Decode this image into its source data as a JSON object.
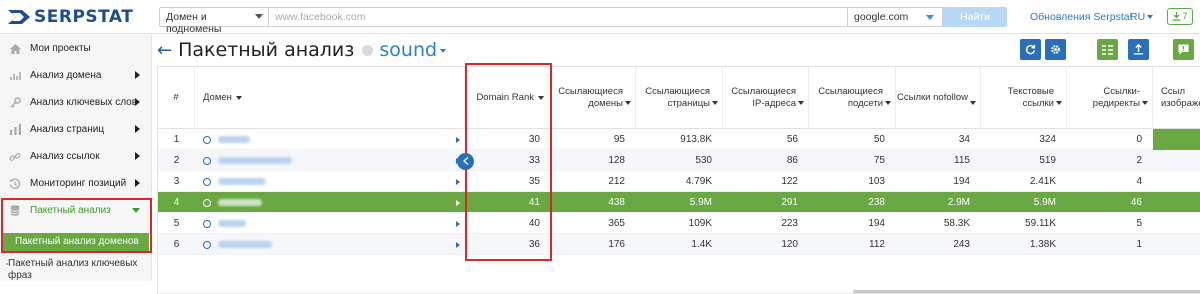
{
  "app": {
    "logo_text": "SERPSTAT",
    "search_type": "Домен и подномены",
    "search_placeholder": "www.facebook.com",
    "engine": "google.com",
    "find_label": "Найти",
    "updates_label": "Обновления Serpstat",
    "lang": "RU",
    "download_count": "7"
  },
  "sidebar": {
    "items": [
      {
        "label": "Мои проекты",
        "icon": "home-icon"
      },
      {
        "label": "Анализ домена",
        "icon": "domain-chart-icon"
      },
      {
        "label": "Анализ ключевых слов",
        "icon": "key-icon"
      },
      {
        "label": "Анализ страниц",
        "icon": "bar-chart-icon"
      },
      {
        "label": "Анализ ссылок",
        "icon": "link-icon"
      },
      {
        "label": "Мониторинг позиций",
        "icon": "history-icon"
      },
      {
        "label": "Пакетный анализ",
        "icon": "database-icon"
      }
    ],
    "sub_active": "Пакетный анализ доменов",
    "sub_item": "Пакетный анализ ключевых фраз"
  },
  "page": {
    "title": "Пакетный анализ",
    "keyword": "sound"
  },
  "colors": {
    "accent_blue": "#2a6fbd",
    "green": "#6aa844",
    "highlight_red": "#d9272e"
  },
  "table": {
    "headers": [
      "#",
      "Домен",
      "Domain Rank",
      "Ссылающиеся домены",
      "Ссылающиеся страницы",
      "Ссылающиеся IP-адреса",
      "Ссылающиеся подсети",
      "Ссылки nofollow",
      "Текстовые ссылки",
      "Ссылки-редиректы",
      "Ссыл изображе"
    ],
    "rows": [
      {
        "num": "1",
        "domain_width": 32,
        "rank": "30",
        "ref_domains": "95",
        "ref_pages": "913.8K",
        "ref_ips": "56",
        "ref_subnets": "50",
        "nofollow": "34",
        "text_links": "324",
        "redirects": "0"
      },
      {
        "num": "2",
        "domain_width": 74,
        "rank": "33",
        "ref_domains": "128",
        "ref_pages": "530",
        "ref_ips": "86",
        "ref_subnets": "75",
        "nofollow": "115",
        "text_links": "519",
        "redirects": "2"
      },
      {
        "num": "3",
        "domain_width": 48,
        "rank": "35",
        "ref_domains": "212",
        "ref_pages": "4.79K",
        "ref_ips": "122",
        "ref_subnets": "103",
        "nofollow": "194",
        "text_links": "2.41K",
        "redirects": "4"
      },
      {
        "num": "4",
        "domain_width": 44,
        "rank": "41",
        "ref_domains": "438",
        "ref_pages": "5.9M",
        "ref_ips": "291",
        "ref_subnets": "238",
        "nofollow": "2.9M",
        "text_links": "5.9M",
        "redirects": "46"
      },
      {
        "num": "5",
        "domain_width": 28,
        "rank": "40",
        "ref_domains": "365",
        "ref_pages": "109K",
        "ref_ips": "223",
        "ref_subnets": "194",
        "nofollow": "58.3K",
        "text_links": "59.11K",
        "redirects": "5"
      },
      {
        "num": "6",
        "domain_width": 54,
        "rank": "36",
        "ref_domains": "176",
        "ref_pages": "1.4K",
        "ref_ips": "120",
        "ref_subnets": "112",
        "nofollow": "243",
        "text_links": "1.38K",
        "redirects": "1"
      }
    ]
  }
}
